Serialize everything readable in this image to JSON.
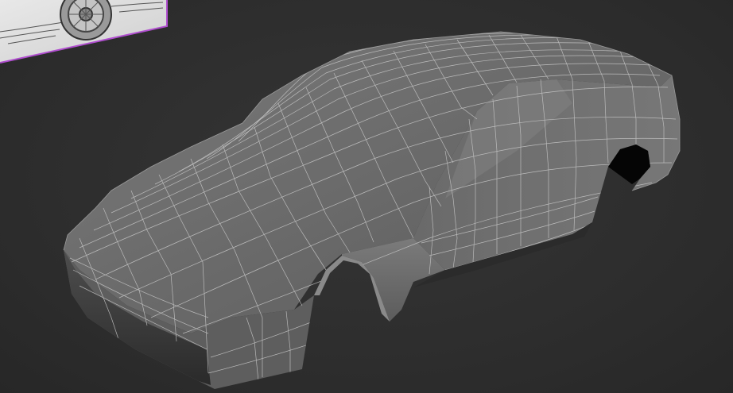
{
  "viewport": {
    "background_color": "#2f2f2f",
    "reference_frame_color": "#b04ecf",
    "mesh_base_color": "#6e6e6e",
    "wire_color": "#c9c9c9"
  },
  "reference_image": {
    "icon": "car-side-sketch-icon"
  },
  "mesh": {
    "icon": "car-body-polygon-mesh-icon"
  }
}
